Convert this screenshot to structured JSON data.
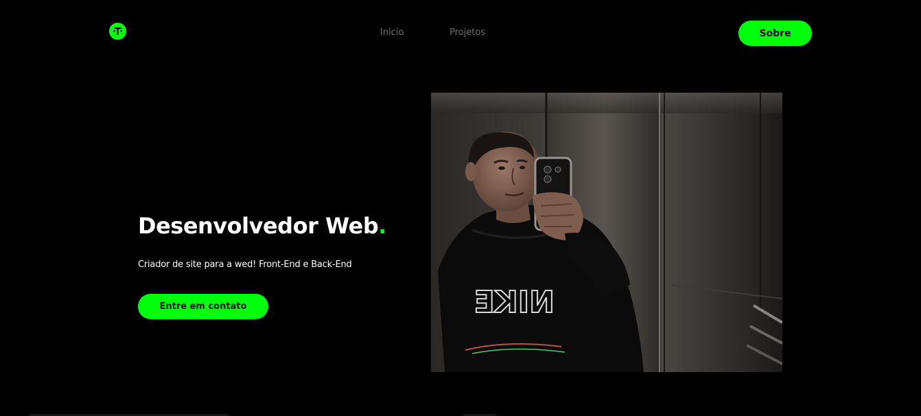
{
  "brand": {
    "logo_icon": "t-logo-icon",
    "accent_color": "#00ff0d",
    "background_color": "#000000"
  },
  "nav": {
    "items": [
      {
        "label": "Inicio"
      },
      {
        "label": "Projetos"
      }
    ],
    "cta_label": "Sobre"
  },
  "hero": {
    "title": "Desenvolvedor Web",
    "title_dot": ".",
    "subtitle": "Criador de site para a wed! Front-End e Back-End",
    "cta_label": "Entre em contato"
  },
  "photo": {
    "icon": "profile-photo",
    "shirt_text": "NIKE"
  }
}
